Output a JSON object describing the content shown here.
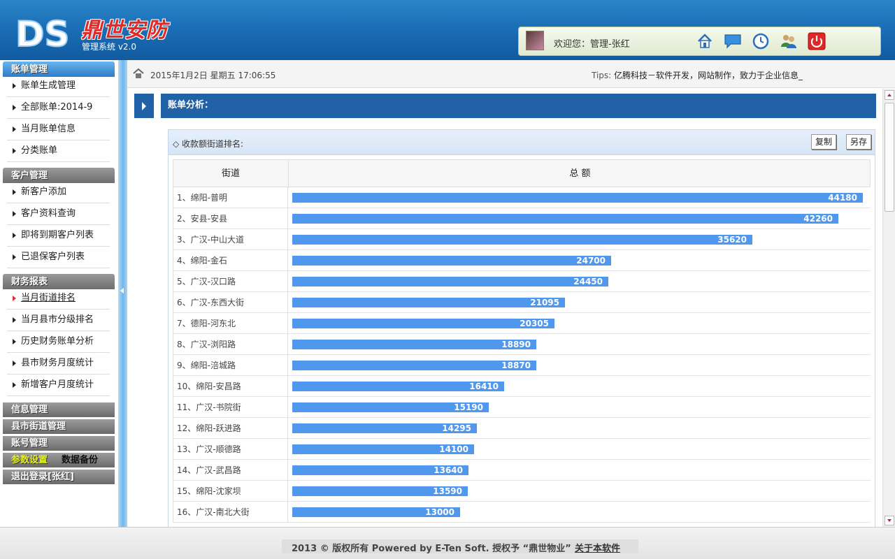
{
  "header": {
    "logo_title": "鼎世安防",
    "logo_sub": "管理系统 v2.0",
    "welcome": "欢迎您：管理-张红",
    "icons": [
      "home-icon",
      "message-icon",
      "clock-icon",
      "users-icon",
      "power-icon"
    ]
  },
  "sidebar": {
    "groups": [
      {
        "title": "账单管理",
        "items": [
          "账单生成管理",
          "全部账单:2014-9",
          "当月账单信息",
          "分类账单"
        ]
      },
      {
        "title": "客户管理",
        "items": [
          "新客户添加",
          "客户资料查询",
          "即将到期客户列表",
          "已退保客户列表"
        ]
      },
      {
        "title": "财务报表",
        "items": [
          "当月街道排名",
          "当月县市分级排名",
          "历史财务账单分析",
          "县市财务月度统计",
          "新增客户月度统计"
        ]
      }
    ],
    "solo": [
      "信息管理",
      "县市街道管理",
      "账号管理"
    ],
    "param_settings": "参数设置",
    "data_backup": "数据备份",
    "logout": "退出登录[张红]"
  },
  "topbar": {
    "datetime": "2015年1月2日 星期五 17:06:55",
    "tips_label": "Tips:",
    "tips_text": "亿腾科技－软件开发，网站制作，致力于企业信息_"
  },
  "section": {
    "title": "账单分析："
  },
  "panel": {
    "title": "◇ 收款额街道排名:",
    "copy_label": "复制",
    "save_as_label": "另存"
  },
  "chart_data": {
    "type": "bar",
    "column_headers": [
      "街道",
      "总 额"
    ],
    "categories": [
      "1、绵阳-普明",
      "2、安县-安县",
      "3、广汉-中山大道",
      "4、绵阳-金石",
      "5、广汉-汉口路",
      "6、广汉-东西大街",
      "7、德阳-河东北",
      "8、广汉-浏阳路",
      "9、绵阳-涪城路",
      "10、绵阳-安昌路",
      "11、广汉-书院街",
      "12、绵阳-跃进路",
      "13、广汉-顺德路",
      "14、广汉-武昌路",
      "15、绵阳-沈家坝",
      "16、广汉-南北大街"
    ],
    "values": [
      44180,
      42260,
      35620,
      24700,
      24450,
      21095,
      20305,
      18890,
      18870,
      16410,
      15190,
      14295,
      14100,
      13640,
      13590,
      13000
    ],
    "bar_color": "#4f98ee"
  },
  "footer": {
    "text": "2013 © 版权所有  Powered by E-Ten Soft.   授权予 “鼎世物业”",
    "about": "关于本软件"
  }
}
